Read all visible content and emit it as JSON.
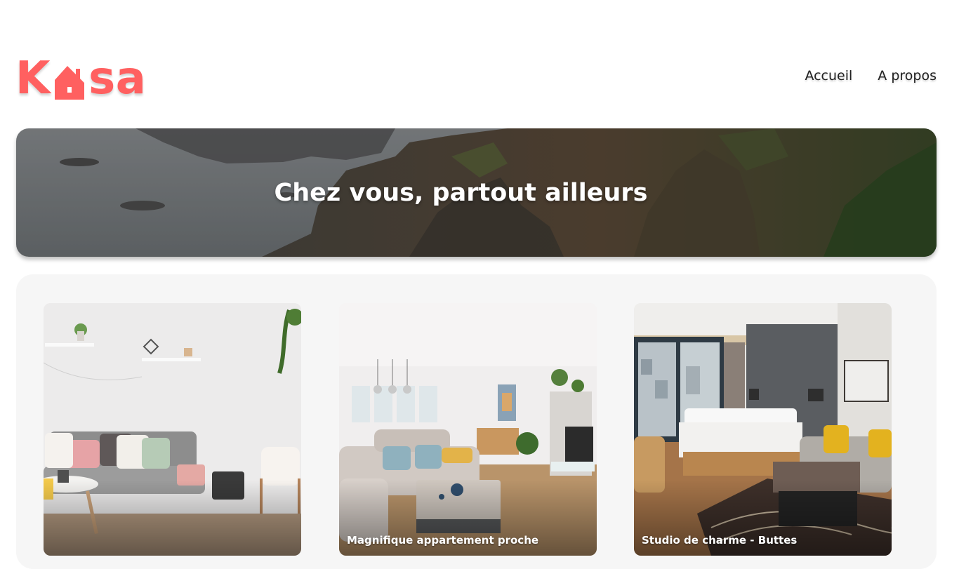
{
  "header": {
    "logo": {
      "prefix": "K",
      "suffix": "sa",
      "full": "Kasa"
    },
    "nav": [
      {
        "label": "Accueil"
      },
      {
        "label": "A propos"
      }
    ]
  },
  "banner": {
    "title": "Chez vous, partout ailleurs"
  },
  "gallery": {
    "cards": [
      {
        "title": ""
      },
      {
        "title": "Magnifique appartement proche"
      },
      {
        "title": "Studio de charme - Buttes"
      }
    ]
  },
  "colors": {
    "brand": "#ff6060",
    "nav_text": "#222222",
    "gallery_bg": "#f6f6f6"
  }
}
